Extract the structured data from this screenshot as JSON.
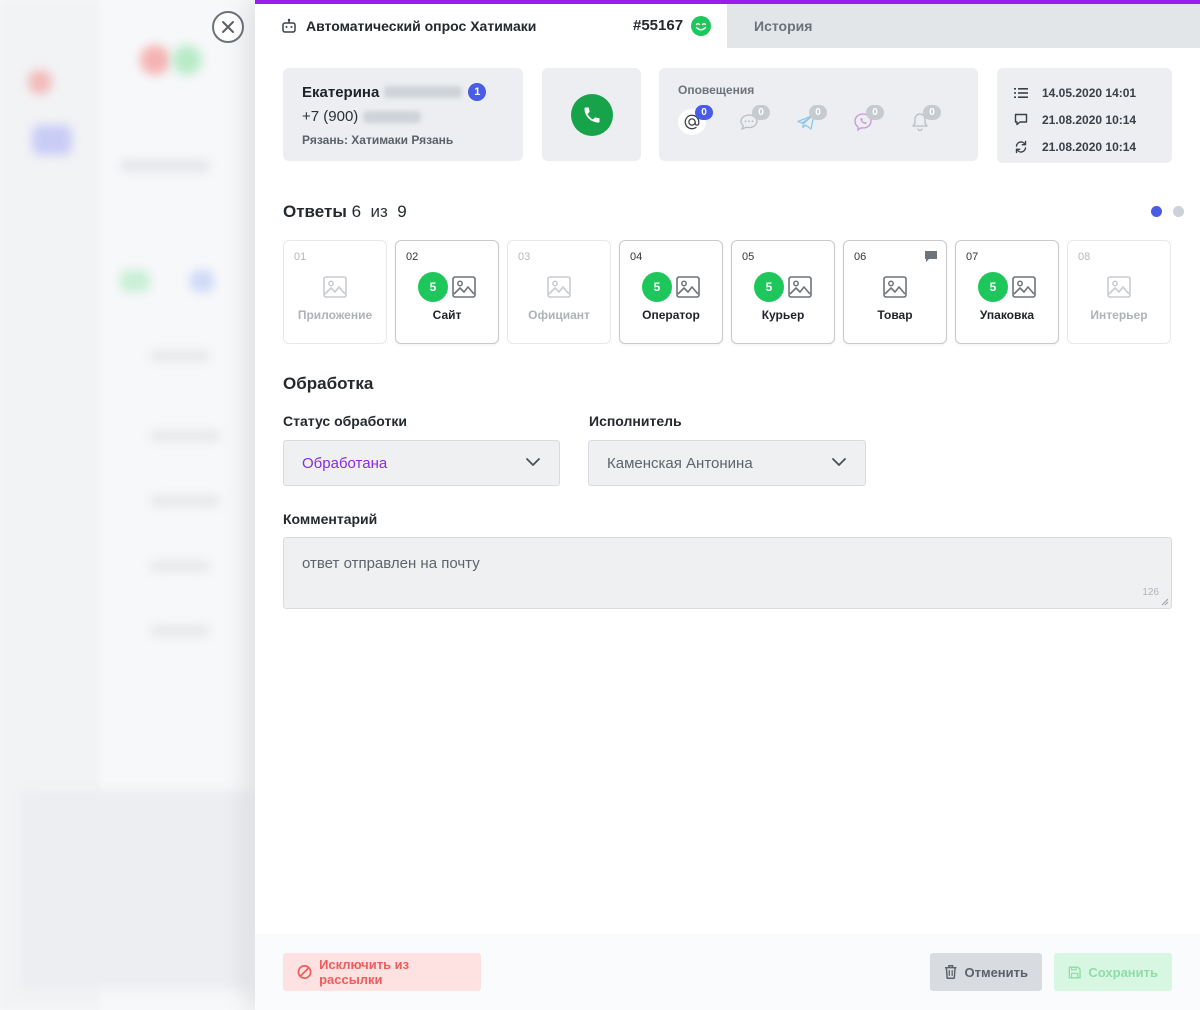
{
  "colors": {
    "accent": "#9b1ee8",
    "primary_blue": "#4a5be6",
    "success_green": "#1ec75c",
    "call_green": "#17a34a",
    "danger": "#f25b5b",
    "status_value": "#8a2be2"
  },
  "header": {
    "title": "Автоматический опрос Хатимаки",
    "order_number": "#55167",
    "history_tab": "История",
    "mood_icon": "smile-icon"
  },
  "client": {
    "first_name": "Екатерина",
    "badge_count": "1",
    "phone_prefix": "+7 (900)",
    "city": "Рязань: Хатимаки Рязань"
  },
  "notifications": {
    "label": "Оповещения",
    "channels": [
      {
        "icon": "email-icon",
        "count": "0",
        "active": true
      },
      {
        "icon": "chat-icon",
        "count": "0",
        "active": false
      },
      {
        "icon": "telegram-icon",
        "count": "0",
        "active": false
      },
      {
        "icon": "viber-icon",
        "count": "0",
        "active": false
      },
      {
        "icon": "bell-icon",
        "count": "0",
        "active": false
      }
    ]
  },
  "dates": {
    "created": "14.05.2020 14:01",
    "commented": "21.08.2020 10:14",
    "updated": "21.08.2020 10:14"
  },
  "answers": {
    "title": "Ответы",
    "answered": "6",
    "of": "из",
    "total": "9",
    "items": [
      {
        "idx": "01",
        "label": "Приложение",
        "score": null,
        "filled": false
      },
      {
        "idx": "02",
        "label": "Сайт",
        "score": "5",
        "filled": true
      },
      {
        "idx": "03",
        "label": "Официант",
        "score": null,
        "filled": false
      },
      {
        "idx": "04",
        "label": "Оператор",
        "score": "5",
        "filled": true
      },
      {
        "idx": "05",
        "label": "Курьер",
        "score": "5",
        "filled": true
      },
      {
        "idx": "06",
        "label": "Товар",
        "score": null,
        "filled": true,
        "has_comment": true
      },
      {
        "idx": "07",
        "label": "Упаковка",
        "score": "5",
        "filled": true
      },
      {
        "idx": "08",
        "label": "Интерьер",
        "score": null,
        "filled": false
      }
    ]
  },
  "processing": {
    "title": "Обработка",
    "status_label": "Статус обработки",
    "status_value": "Обработана",
    "executor_label": "Исполнитель",
    "executor_value": "Каменская Антонина",
    "comment_label": "Комментарий",
    "comment_value": "ответ отправлен на почту",
    "comment_counter": "126"
  },
  "footer": {
    "exclude_label": "Исключить из рассылки",
    "cancel_label": "Отменить",
    "save_label": "Сохранить"
  }
}
